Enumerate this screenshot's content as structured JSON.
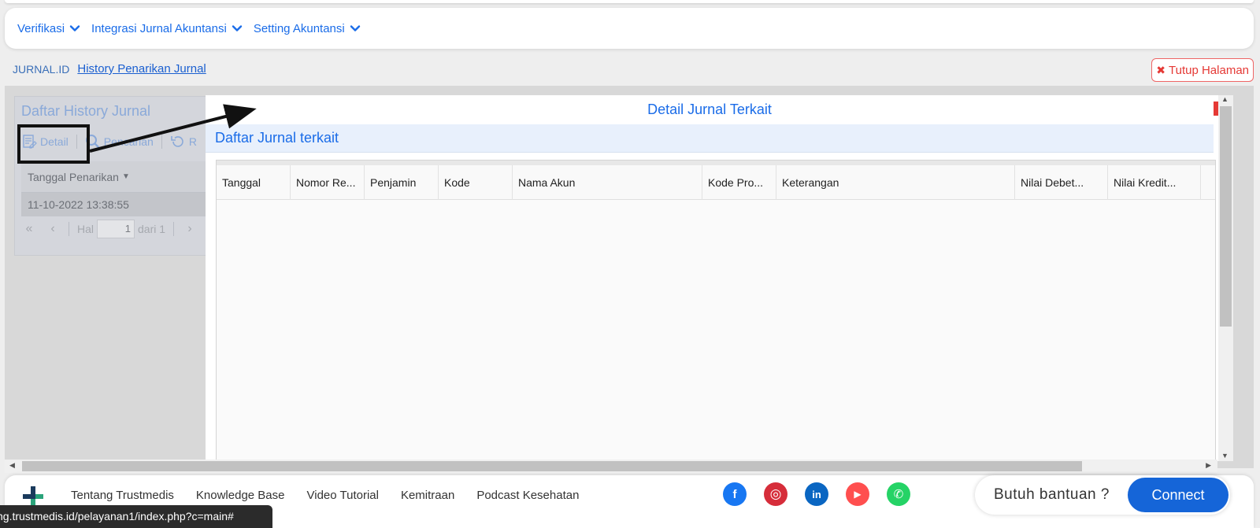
{
  "menu": {
    "items": [
      {
        "label": "Verifikasi"
      },
      {
        "label": "Integrasi Jurnal Akuntansi"
      },
      {
        "label": "Setting Akuntansi"
      }
    ]
  },
  "breadcrumb": {
    "root": "JURNAL.ID",
    "current": "History Penarikan Jurnal"
  },
  "close_page_label": "Tutup Halaman",
  "left_panel": {
    "title": "Daftar History Jurnal",
    "toolbar": {
      "detail": "Detail",
      "search": "Pencarian",
      "refresh": "R"
    },
    "column_header": "Tanggal Penarikan",
    "rows": [
      "11-10-2022 13:38:55"
    ],
    "pager": {
      "page_label": "Hal",
      "page_value": "1",
      "total_label": "dari 1"
    }
  },
  "dialog": {
    "title": "Detail Jurnal Terkait",
    "subheader": "Daftar Jurnal terkait",
    "columns": [
      "Tanggal",
      "Nomor Re...",
      "Penjamin",
      "Kode",
      "Nama Akun",
      "Kode Pro...",
      "Keterangan",
      "Nilai Debet...",
      "Nilai Kredit..."
    ]
  },
  "footer": {
    "links": [
      "Tentang Trustmedis",
      "Knowledge Base",
      "Video Tutorial",
      "Kemitraan",
      "Podcast Kesehatan"
    ],
    "social": [
      {
        "icon": "facebook-icon",
        "color": "#1877f2",
        "glyph": "f"
      },
      {
        "icon": "instagram-icon",
        "color": "#d62d3a",
        "glyph": "◎"
      },
      {
        "icon": "linkedin-icon",
        "color": "#0a66c2",
        "glyph": "in"
      },
      {
        "icon": "youtube-icon",
        "color": "#ff4f4f",
        "glyph": "▶"
      },
      {
        "icon": "whatsapp-icon",
        "color": "#25d366",
        "glyph": "✆"
      }
    ],
    "help_text": "Butuh bantuan ?",
    "connect_label": "Connect"
  },
  "status_url": "ng.trustmedis.id/pelayanan1/index.php?c=main#",
  "colors": {
    "accent": "#1a6ce8",
    "danger": "#e53935",
    "connect": "#1565d8"
  }
}
